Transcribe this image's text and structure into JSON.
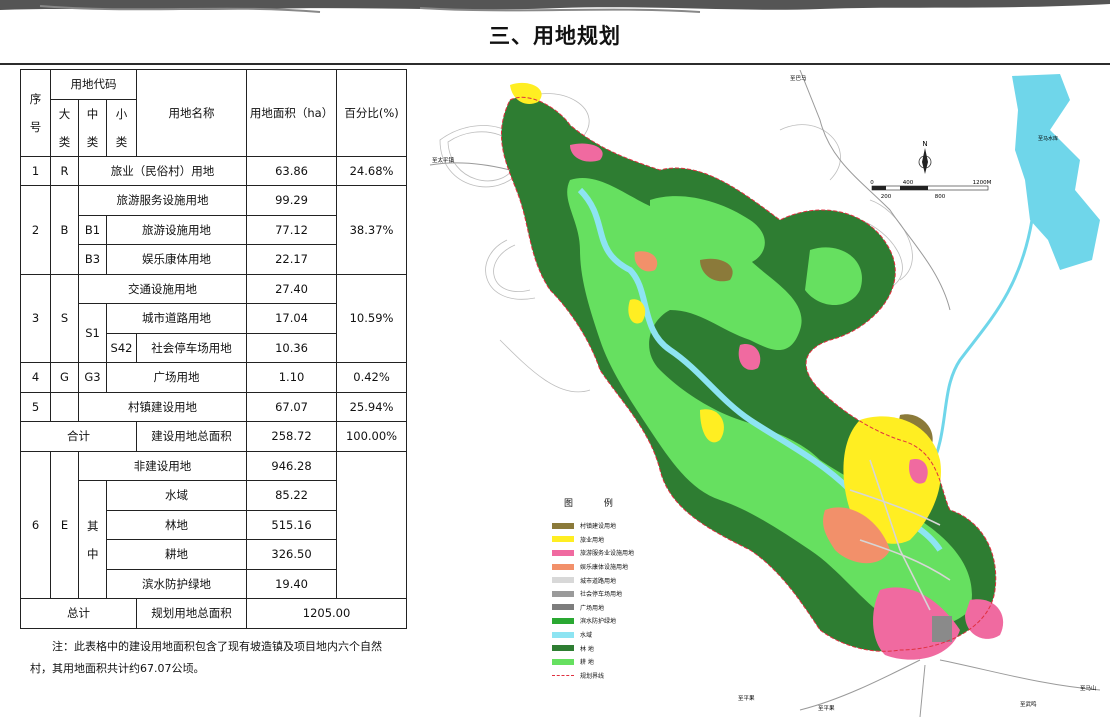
{
  "title": "三、用地规划",
  "table": {
    "h_seq": "序号",
    "h_code": "用地代码",
    "h_major": "大类",
    "h_middle": "中类",
    "h_minor": "小类",
    "h_name": "用地名称",
    "h_area": "用地面积（ha）",
    "h_pct": "百分比(%)",
    "r1": {
      "seq": "1",
      "major": "R",
      "name": "旅业（民俗村）用地",
      "area": "63.86",
      "pct": "24.68%"
    },
    "r2": {
      "seq": "2",
      "major": "B",
      "name": "旅游服务设施用地",
      "area": "99.29",
      "pct": "38.37%",
      "b1_code": "B1",
      "b1_name": "旅游设施用地",
      "b1_area": "77.12",
      "b3_code": "B3",
      "b3_name": "娱乐康体用地",
      "b3_area": "22.17"
    },
    "r3": {
      "seq": "3",
      "major": "S",
      "name": "交通设施用地",
      "area": "27.40",
      "pct": "10.59%",
      "s1_code": "S1",
      "s1_name": "城市道路用地",
      "s1_area": "17.04",
      "s42_code": "S42",
      "s42_name": "社会停车场用地",
      "s42_area": "10.36"
    },
    "r4": {
      "seq": "4",
      "major": "G",
      "middle": "G3",
      "name": "广场用地",
      "area": "1.10",
      "pct": "0.42%"
    },
    "r5": {
      "seq": "5",
      "name": "村镇建设用地",
      "area": "67.07",
      "pct": "25.94%"
    },
    "subtotal": {
      "label": "合计",
      "name": "建设用地总面积",
      "area": "258.72",
      "pct": "100.00%"
    },
    "r6": {
      "seq": "6",
      "major": "E",
      "name": "非建设用地",
      "area": "946.28",
      "middle": "其中",
      "water": "水域",
      "water_area": "85.22",
      "forest": "林地",
      "forest_area": "515.16",
      "farm": "耕地",
      "farm_area": "326.50",
      "green": "滨水防护绿地",
      "green_area": "19.40"
    },
    "total": {
      "label": "总计",
      "name": "规划用地总面积",
      "area": "1205.00"
    }
  },
  "note": "注：此表格中的建设用地面积包含了现有坡造镇及项目地内六个自然村，其用地面积共计约67.07公顷。",
  "map": {
    "north": "N",
    "scale_ticks": [
      "0",
      "200",
      "400",
      "800",
      "1200M"
    ],
    "labels": [
      "至巴马",
      "至太平镇",
      "至平果",
      "至平果",
      "至马山",
      "至武鸣",
      "至马水库"
    ],
    "legend_title": "图  例",
    "legend": [
      {
        "name": "村镇建设用地",
        "color": "#8b7a3a"
      },
      {
        "name": "旅业用地",
        "color": "#ffee22"
      },
      {
        "name": "旅游服务业设施用地",
        "color": "#f06aa0"
      },
      {
        "name": "娱乐康体设施用地",
        "color": "#f2906a"
      },
      {
        "name": "城市道路用地",
        "color": "#d8d8d8"
      },
      {
        "name": "社会停车场用地",
        "color": "#9a9a9a"
      },
      {
        "name": "广场用地",
        "color": "#7d7d7d"
      },
      {
        "name": "滨水防护绿地",
        "color": "#2aa832"
      },
      {
        "name": "水域",
        "color": "#8de4f2"
      },
      {
        "name": "林    地",
        "color": "#2e7d32"
      },
      {
        "name": "耕    地",
        "color": "#66e060"
      },
      {
        "name": "规划界线",
        "color": "#e03040"
      }
    ]
  }
}
